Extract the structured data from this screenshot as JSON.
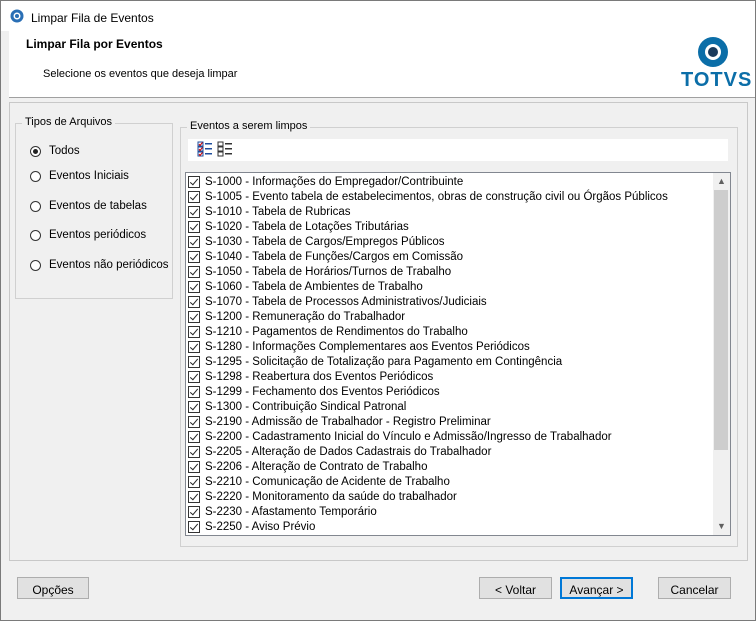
{
  "window": {
    "title": "Limpar Fila de Eventos"
  },
  "header": {
    "title": "Limpar Fila por Eventos",
    "subtitle": "Selecione os eventos que deseja limpar",
    "logo_text": "TOTVS",
    "brand_color": "#0b6ea8"
  },
  "file_types": {
    "legend": "Tipos de Arquivos",
    "options": [
      {
        "label": "Todos",
        "checked": true
      },
      {
        "label": "Eventos Iniciais",
        "checked": false
      },
      {
        "label": "Eventos de tabelas",
        "checked": false
      },
      {
        "label": "Eventos periódicos",
        "checked": false
      },
      {
        "label": "Eventos não periódicos",
        "checked": false
      }
    ]
  },
  "events": {
    "legend": "Eventos a serem limpos",
    "toolbar": [
      "check-all-icon",
      "uncheck-all-icon"
    ],
    "items": [
      "S-1000 - Informações do Empregador/Contribuinte",
      "S-1005 - Evento tabela de estabelecimentos, obras de construção civil ou Órgãos Públicos",
      "S-1010 - Tabela de Rubricas",
      "S-1020 - Tabela de Lotações Tributárias",
      "S-1030 - Tabela de Cargos/Empregos Públicos",
      "S-1040 - Tabela de Funções/Cargos em Comissão",
      "S-1050 - Tabela de Horários/Turnos de Trabalho",
      "S-1060 - Tabela de Ambientes de Trabalho",
      "S-1070 - Tabela de Processos Administrativos/Judiciais",
      "S-1200 - Remuneração do Trabalhador",
      "S-1210 - Pagamentos de Rendimentos do Trabalho",
      "S-1280 - Informações Complementares aos Eventos Periódicos",
      "S-1295 - Solicitação de Totalização para Pagamento em Contingência",
      "S-1298 - Reabertura dos Eventos Periódicos",
      "S-1299 - Fechamento dos Eventos Periódicos",
      "S-1300 - Contribuição Sindical Patronal",
      "S-2190 - Admissão de Trabalhador - Registro Preliminar",
      "S-2200 - Cadastramento Inicial do Vínculo e Admissão/Ingresso de Trabalhador",
      "S-2205 - Alteração de Dados Cadastrais do Trabalhador",
      "S-2206 - Alteração de Contrato de Trabalho",
      "S-2210 - Comunicação de Acidente de Trabalho",
      "S-2220 - Monitoramento da saúde do trabalhador",
      "S-2230 - Afastamento Temporário",
      "S-2250 - Aviso Prévio"
    ]
  },
  "buttons": {
    "options": "Opções",
    "back": "< Voltar",
    "next": "Avançar >",
    "cancel": "Cancelar"
  }
}
